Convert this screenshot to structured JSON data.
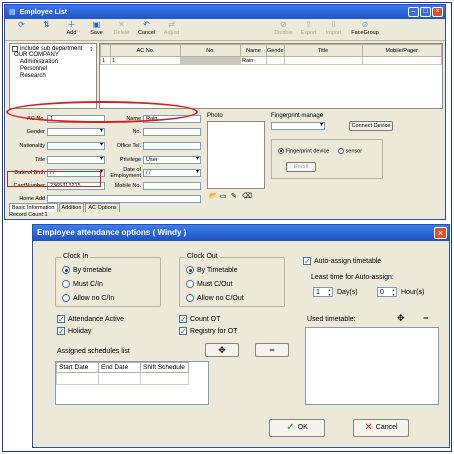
{
  "win1": {
    "title": "Employee List",
    "toolbar": [
      {
        "label": "",
        "icon": "refresh-icon",
        "icon_glyph": "⟳",
        "disabled": false
      },
      {
        "label": "",
        "icon": "sort-icon",
        "icon_glyph": "⇅",
        "disabled": false
      },
      {
        "label": "Add",
        "icon": "add-icon",
        "icon_glyph": "＋",
        "disabled": false
      },
      {
        "label": "Save",
        "icon": "save-icon",
        "icon_glyph": "▣",
        "disabled": false
      },
      {
        "label": "Delete",
        "icon": "delete-icon",
        "icon_glyph": "✕",
        "disabled": true
      },
      {
        "label": "Cancel",
        "icon": "cancel-icon",
        "icon_glyph": "↶",
        "disabled": false
      },
      {
        "label": "Adjust",
        "icon": "adjust-icon",
        "icon_glyph": "⇄",
        "disabled": true
      },
      {
        "label": "",
        "icon": "blank-icon",
        "icon_glyph": "",
        "disabled": true
      },
      {
        "label": "",
        "icon": "blank-icon",
        "icon_glyph": "",
        "disabled": true
      },
      {
        "label": "",
        "icon": "blank-icon",
        "icon_glyph": "",
        "disabled": true
      },
      {
        "label": "Disable",
        "icon": "disable-icon",
        "icon_glyph": "⊘",
        "disabled": true
      },
      {
        "label": "Export",
        "icon": "export-icon",
        "icon_glyph": "⇪",
        "disabled": true
      },
      {
        "label": "Import",
        "icon": "import-icon",
        "icon_glyph": "⇩",
        "disabled": true
      },
      {
        "label": "FaceGroup",
        "icon": "face-group-icon",
        "icon_glyph": "☺",
        "disabled": false
      }
    ],
    "tree": {
      "include_sub": "include sub department",
      "root": "OUR COMPANY",
      "children": [
        "Administration",
        "Personnel",
        "Research"
      ]
    },
    "grid": {
      "headers": [
        "",
        "AC No.",
        "No.",
        "Name",
        "Gende",
        "Title",
        "Mobile/Pager"
      ],
      "rows": [
        [
          "1",
          "1",
          "",
          "Rain",
          "",
          "",
          ""
        ]
      ]
    },
    "form": {
      "ac_no_label": "AC No.",
      "ac_no_value": "1",
      "name_label": "Name",
      "name_value": "Rain",
      "gender_label": "Gender",
      "no_label": "No.",
      "nationality_label": "Nationality",
      "office_tel_label": "Office Tel.",
      "title_label": "Title",
      "privilege_label": "Privilege",
      "privilege_value": "User",
      "dob_label": "Date of Birth",
      "dob_value": "/ /",
      "doe_label": "Date of Employment",
      "doe_value": "/ /",
      "card_label": "CardNumber",
      "card_value": "2365313215",
      "mobile_label": "Mobile No.",
      "home_label": "Home Add",
      "photo_label": "Photo",
      "fp_label": "Fingerprint manage",
      "connect_btn": "Connect Device",
      "fp_device": "Fingerprint device",
      "fp_sensor": "sensor",
      "enroll_btn": "Enroll"
    },
    "tabs": [
      "Basic Information",
      "Addition",
      "AC Options"
    ],
    "status": "Record Count:1"
  },
  "win2": {
    "title": "Employee attendance options ( Windy )",
    "clock_in": {
      "title": "Clock In",
      "options": [
        "By timetable",
        "Must C/In",
        "Allow no C/In"
      ],
      "selected": 0
    },
    "clock_out": {
      "title": "Clock Out",
      "options": [
        "By Timetable",
        "Must C/Out",
        "Allow no C/Out"
      ],
      "selected": 0
    },
    "auto_assign": "Auto-assign timetable",
    "least_time": "Least time for Auto-assign:",
    "days_value": "1",
    "days_label": "Day(s)",
    "hours_value": "0",
    "hours_label": "Hour(s)",
    "attendance_active": "Attendance Active",
    "holiday": "Holiday",
    "count_ot": "Count OT",
    "registry_ot": "Registry for OT",
    "used_timetable": "Used timetable:",
    "assigned_list": "Assigned schedules list",
    "schedule_headers": [
      "Start Date",
      "End Date",
      "Shift Schedule"
    ],
    "ok_label": "OK",
    "cancel_label": "Cancel"
  }
}
